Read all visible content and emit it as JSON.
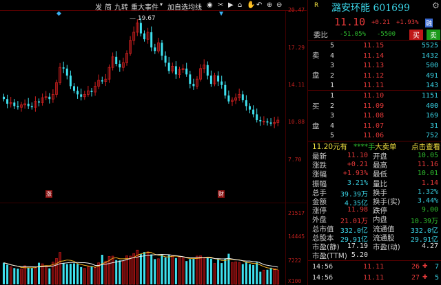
{
  "toolbar": {
    "items": [
      "发",
      "简",
      "九转",
      "重大事件",
      "加自选",
      "均线"
    ],
    "dropdown": "▾",
    "icons": [
      "eye-icon",
      "scissors-icon",
      "play-icon",
      "lock-icon",
      "hand-icon",
      "undo-icon",
      "zoom-in-icon",
      "zoom-out-icon"
    ]
  },
  "price_axis": [
    "20.47",
    "17.29",
    "14.11",
    "10.88",
    "7.70"
  ],
  "volume_axis": [
    "21517",
    "14445",
    "7222",
    "X100"
  ],
  "peak_label": "19.67",
  "events": [
    "涨",
    "财"
  ],
  "colors": {
    "up": "#d02020",
    "down": "#3ee0ee",
    "bg": "#000000",
    "ma5": "#f0f0f0",
    "ma10": "#f0b020"
  },
  "chart_data": {
    "type": "candlestick",
    "title": "潞安环能 601699 daily K-line",
    "ylim": [
      7.7,
      20.47
    ],
    "volume_ylim": [
      0,
      21517
    ],
    "first_open": 13.1,
    "closes": [
      12.9,
      12.5,
      12.6,
      12.3,
      12.2,
      12.4,
      12.5,
      12.3,
      12.2,
      12.7,
      12.6,
      13.0,
      13.1,
      12.9,
      13.3,
      14.3,
      15.6,
      15.5,
      14.9,
      14.0,
      13.6,
      13.3,
      13.1,
      13.3,
      13.6,
      13.5,
      14.0,
      14.5,
      14.4,
      14.6,
      15.6,
      16.5,
      15.9,
      15.6,
      16.0,
      16.8,
      17.9,
      18.6,
      19.4,
      18.5,
      18.0,
      18.6,
      17.3,
      17.0,
      17.7,
      16.6,
      16.0,
      15.3,
      15.7,
      15.0,
      15.4,
      15.5,
      15.0,
      14.2,
      14.0,
      14.6,
      15.5,
      15.8,
      14.9,
      14.2,
      14.9,
      14.4,
      14.1,
      13.2,
      12.7,
      12.8,
      13.0,
      13.3,
      12.8,
      12.3,
      12.0,
      11.6,
      11.1,
      11.0,
      11.0,
      10.9,
      10.8,
      10.9,
      11.1
    ],
    "volumes": [
      6500,
      5900,
      5300,
      4900,
      4700,
      4600,
      5600,
      5100,
      4900,
      5000,
      6500,
      6200,
      5600,
      4800,
      6700,
      7800,
      9600,
      6400,
      6100,
      6200,
      6300,
      6100,
      5200,
      4800,
      5300,
      5500,
      5000,
      6500,
      8900,
      7000,
      8400,
      8500,
      7300,
      7200,
      7000,
      8600,
      8500,
      9300,
      10300,
      9100,
      9700,
      9800,
      9000,
      7600,
      7700,
      9000,
      8100,
      8800,
      8700,
      7900,
      8300,
      8000,
      7000,
      7600,
      7800,
      8500,
      8600,
      8200,
      7900,
      7700,
      6300,
      7600,
      6400,
      7800,
      9200,
      6600,
      6800,
      6600,
      6100,
      6800,
      6100,
      5800,
      6600,
      3800,
      4300,
      4400,
      5000,
      4800,
      4300
    ]
  },
  "quote": {
    "r_badge": "R",
    "name": "潞安环能 601699",
    "price": "11.10",
    "change": "+0.21",
    "pct": "+1.93%",
    "rong": "融",
    "weibi_label": "委比",
    "weibi": "-51.05%",
    "weicha": "-5500",
    "buy_btn": "买",
    "sell_btn": "卖",
    "sell_label": [
      "卖",
      "盘"
    ],
    "buy_label": [
      "买",
      "盘"
    ],
    "sell": [
      {
        "lvl": "5",
        "price": "11.15",
        "vol": "5525"
      },
      {
        "lvl": "4",
        "price": "11.14",
        "vol": "1432"
      },
      {
        "lvl": "3",
        "price": "11.13",
        "vol": "500"
      },
      {
        "lvl": "2",
        "price": "11.12",
        "vol": "491"
      },
      {
        "lvl": "1",
        "price": "11.11",
        "vol": "143"
      }
    ],
    "buy": [
      {
        "lvl": "1",
        "price": "11.10",
        "vol": "1151"
      },
      {
        "lvl": "2",
        "price": "11.09",
        "vol": "400"
      },
      {
        "lvl": "3",
        "price": "11.08",
        "vol": "169"
      },
      {
        "lvl": "4",
        "price": "11.07",
        "vol": "31"
      },
      {
        "lvl": "5",
        "price": "11.06",
        "vol": "752"
      }
    ],
    "bigorder": {
      "a": "11.20元有",
      "b": "****手",
      "c": "大卖单",
      "d": "点击查看"
    },
    "stats": [
      {
        "l1": "最新",
        "v1": "11.10",
        "c1": "red",
        "l2": "开盘",
        "v2": "10.05",
        "c2": "grn"
      },
      {
        "l1": "涨跌",
        "v1": "+0.21",
        "c1": "red",
        "l2": "最高",
        "v2": "11.16",
        "c2": "red"
      },
      {
        "l1": "涨幅",
        "v1": "+1.93%",
        "c1": "red",
        "l2": "最低",
        "v2": "10.01",
        "c2": "grn"
      },
      {
        "l1": "振幅",
        "v1": "3.21%",
        "c1": "cyn",
        "l2": "量比",
        "v2": "1.14",
        "c2": "red"
      },
      {
        "l1": "总手",
        "v1": "39.39万",
        "c1": "cyn",
        "l2": "换手",
        "v2": "1.32%",
        "c2": "cyn"
      },
      {
        "l1": "金额",
        "v1": "4.35亿",
        "c1": "cyn",
        "l2": "换手(实)",
        "v2": "3.44%",
        "c2": "cyn"
      },
      {
        "l1": "涨停",
        "v1": "11.98",
        "c1": "red",
        "l2": "跌停",
        "v2": "9.00",
        "c2": "grn"
      },
      {
        "l1": "外盘",
        "v1": "21.01万",
        "c1": "red",
        "l2": "内盘",
        "v2": "10.39万",
        "c2": "grn"
      },
      {
        "l1": "总市值",
        "v1": "332.0亿",
        "c1": "cyn",
        "l2": "流通值",
        "v2": "332.0亿",
        "c2": "cyn"
      },
      {
        "l1": "总股本",
        "v1": "29.91亿",
        "c1": "cyn",
        "l2": "流通股",
        "v2": "29.91亿",
        "c2": "cyn"
      },
      {
        "l1": "市盈(静)",
        "v1": "17.19",
        "c1": "wht",
        "l2": "市盈(动)",
        "v2": "4.27",
        "c2": "wht"
      },
      {
        "l1": "市盈(TTM)",
        "v1": "5.20",
        "c1": "wht",
        "l2": "",
        "v2": "",
        "c2": "wht"
      }
    ],
    "ticks": [
      {
        "time": "14:56",
        "price": "11.11",
        "vol": "26",
        "n": "7"
      },
      {
        "time": "14:56",
        "price": "11.11",
        "vol": "27",
        "n": "5"
      }
    ]
  }
}
